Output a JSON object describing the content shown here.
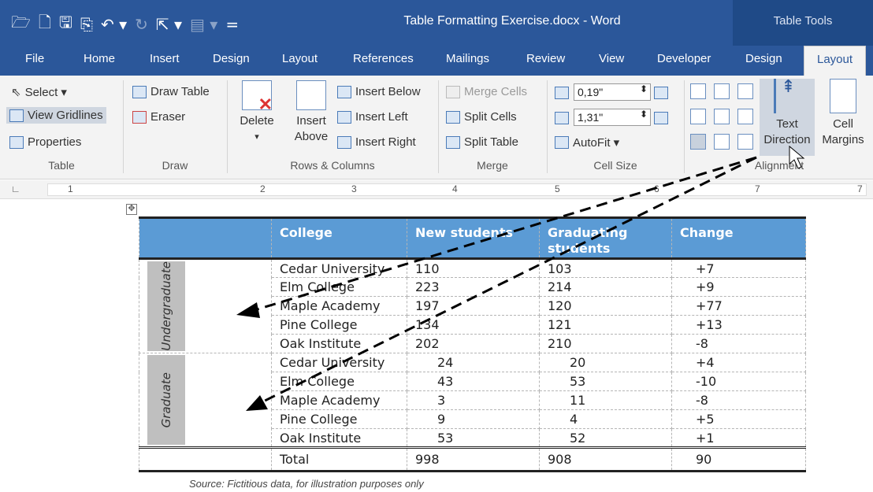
{
  "app": {
    "doc_title": "Table Formatting Exercise.docx  -  Word",
    "contextual_tab": "Table Tools"
  },
  "qat": {
    "open": "🗁",
    "new": "🗋",
    "save": "🖫",
    "saveas": "⎘",
    "undo": "↶ ▾",
    "redo": "↻",
    "touch": "⇱ ▾",
    "more": "▤ ▾",
    "customize": "="
  },
  "tabs": [
    "File",
    "Home",
    "Insert",
    "Design",
    "Layout",
    "References",
    "Mailings",
    "Review",
    "View",
    "Developer",
    "Design",
    "Layout"
  ],
  "ribbon": {
    "table": {
      "select": "Select ▾",
      "view_gridlines": "View Gridlines",
      "properties": "Properties",
      "label": "Table"
    },
    "draw": {
      "draw_table": "Draw Table",
      "eraser": "Eraser",
      "label": "Draw"
    },
    "rows": {
      "delete": "Delete",
      "delete_arrow": "▾",
      "insert_above_1": "Insert",
      "insert_above_2": "Above",
      "insert_below": "Insert Below",
      "insert_left": "Insert Left",
      "insert_right": "Insert Right",
      "label": "Rows & Columns"
    },
    "merge": {
      "merge_cells": "Merge Cells",
      "split_cells": "Split Cells",
      "split_table": "Split Table",
      "label": "Merge"
    },
    "cellsize": {
      "height": "0,19\"",
      "width": "1,31\"",
      "autofit": "AutoFit ▾",
      "label": "Cell Size"
    },
    "alignment": {
      "text_direction_1": "Text",
      "text_direction_2": "Direction",
      "cell_margins_1": "Cell",
      "cell_margins_2": "Margins",
      "label": "Alignment"
    }
  },
  "ruler": [
    "1",
    "2",
    "3",
    "4",
    "5",
    "6",
    "7"
  ],
  "table": {
    "headers": [
      "",
      "College",
      "New students",
      "Graduating students",
      "Change"
    ],
    "groups": [
      {
        "label": "Undergraduate",
        "rows": [
          [
            "Cedar University",
            "110",
            "103",
            "+7"
          ],
          [
            "Elm College",
            "223",
            "214",
            "+9"
          ],
          [
            "Maple Academy",
            "197",
            "120",
            "+77"
          ],
          [
            "Pine College",
            "134",
            "121",
            "+13"
          ],
          [
            "Oak Institute",
            "202",
            "210",
            "-8"
          ]
        ]
      },
      {
        "label": "Graduate",
        "rows": [
          [
            "Cedar University",
            "24",
            "20",
            "+4"
          ],
          [
            "Elm College",
            "43",
            "53",
            "-10"
          ],
          [
            "Maple Academy",
            "3",
            "11",
            "-8"
          ],
          [
            "Pine College",
            "9",
            "4",
            "+5"
          ],
          [
            "Oak Institute",
            "53",
            "52",
            "+1"
          ]
        ]
      }
    ],
    "total": [
      "Total",
      "998",
      "908",
      "90"
    ]
  },
  "caption": "Source: Fictitious data, for illustration purposes only",
  "colors": {
    "title": "#2b579a",
    "header": "#5b9bd5",
    "label_bg": "#bfbfbf"
  }
}
